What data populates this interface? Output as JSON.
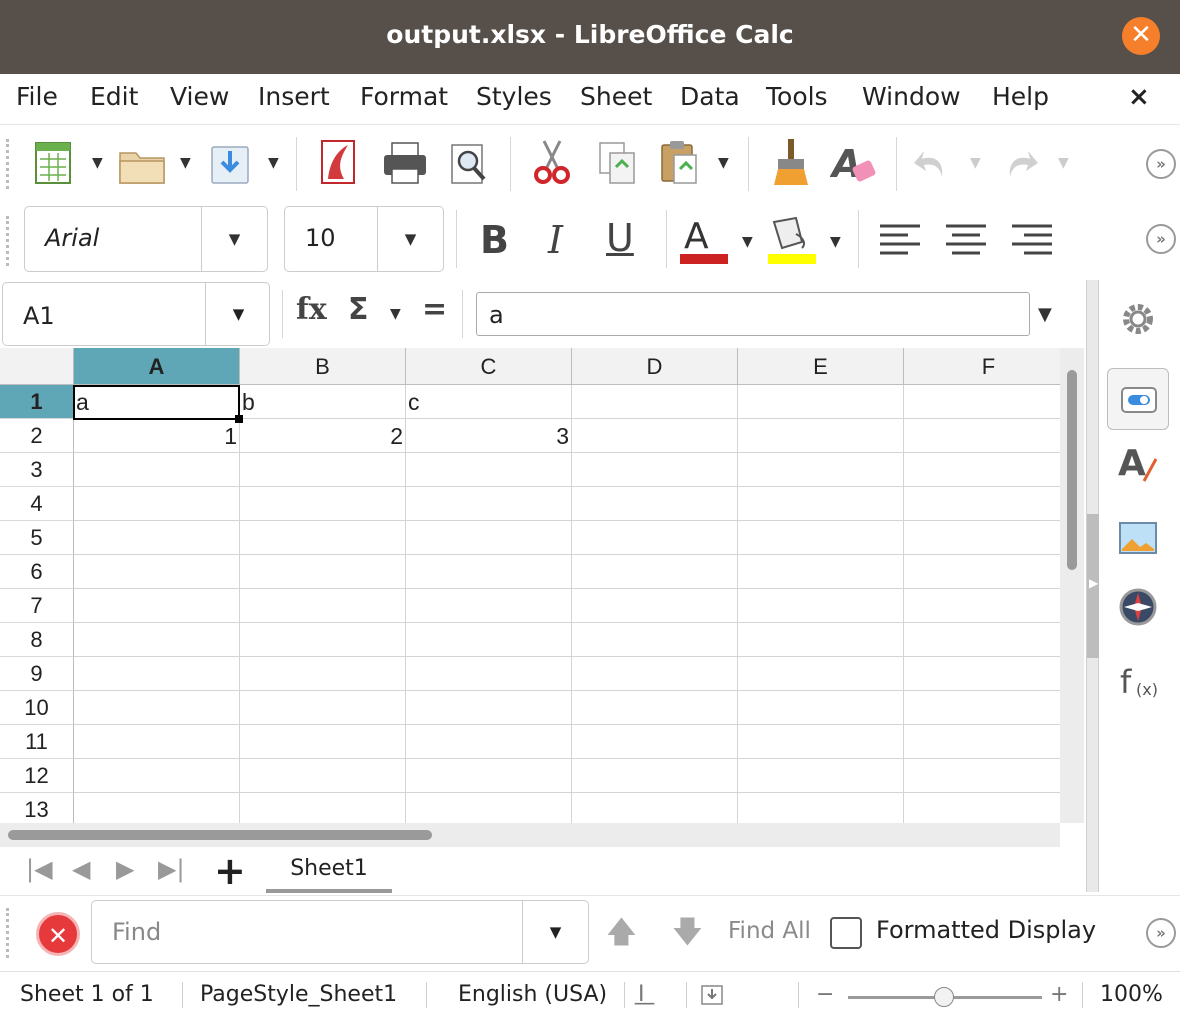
{
  "window": {
    "title": "output.xlsx - LibreOffice Calc",
    "close_icon": "close-icon"
  },
  "menu": [
    "File",
    "Edit",
    "View",
    "Insert",
    "Format",
    "Styles",
    "Sheet",
    "Data",
    "Tools",
    "Window",
    "Help"
  ],
  "menu_close": "×",
  "toolbar_format": {
    "font_name": "Arial",
    "font_size": "10"
  },
  "formula_bar": {
    "name_box": "A1",
    "content": "a"
  },
  "columns": [
    "A",
    "B",
    "C",
    "D",
    "E",
    "F"
  ],
  "rows": [
    "1",
    "2",
    "3",
    "4",
    "5",
    "6",
    "7",
    "8",
    "9",
    "10",
    "11",
    "12",
    "13"
  ],
  "cells": {
    "A1": "a",
    "B1": "b",
    "C1": "c",
    "A2": "1",
    "B2": "2",
    "C2": "3"
  },
  "selected_cell": "A1",
  "sheet_tabs": [
    "Sheet1"
  ],
  "find": {
    "placeholder": "Find",
    "find_all": "Find All",
    "formatted_display": "Formatted Display",
    "formatted_display_checked": false
  },
  "status": {
    "sheet": "Sheet 1 of 1",
    "page_style": "PageStyle_Sheet1",
    "language": "English (USA)",
    "zoom": "100%",
    "zoom_minus": "−",
    "zoom_plus": "+"
  },
  "colors": {
    "titlebar": "#57504a",
    "close_button": "#f57f2a",
    "selection_header": "#5fa7b7",
    "font_color": "#cc2222",
    "highlight_color": "#ffff00"
  }
}
